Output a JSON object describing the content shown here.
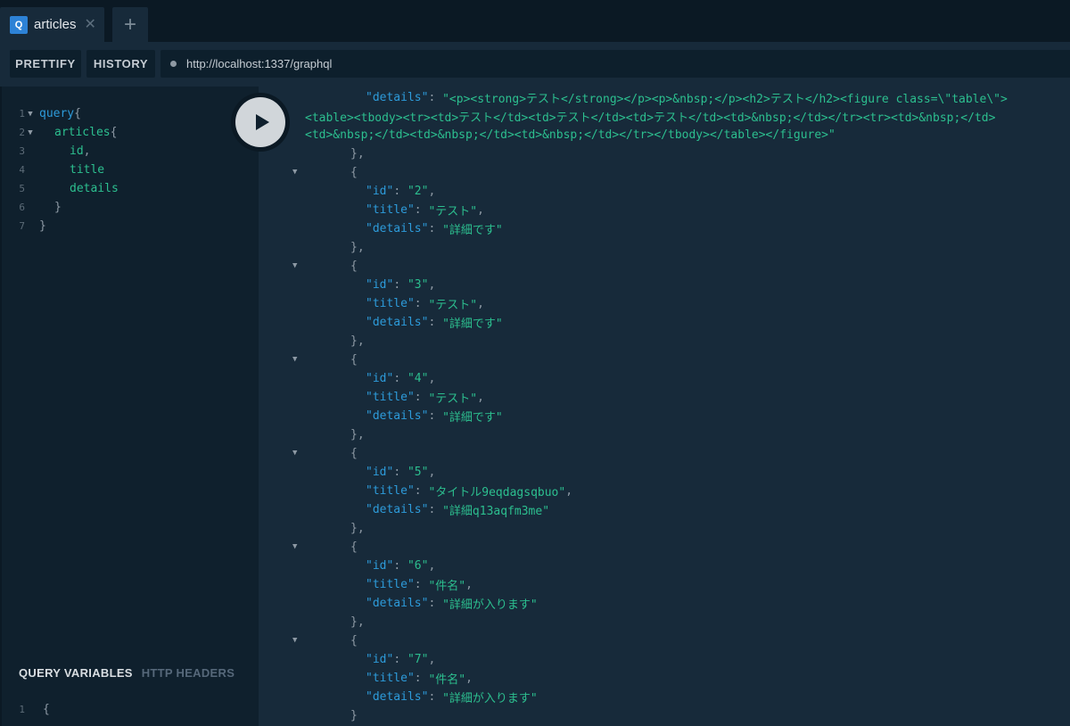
{
  "tab": {
    "icon_letter": "Q",
    "title": "articles",
    "close_glyph": "✕",
    "add_glyph": "+"
  },
  "toolbar": {
    "prettify": "PRETTIFY",
    "history": "HISTORY",
    "url": "http://localhost:1337/graphql"
  },
  "query_lines": [
    {
      "n": "1",
      "indent": 0,
      "arrow": true,
      "parts": [
        {
          "t": "query",
          "c": "kw"
        },
        {
          "t": "{",
          "c": "br"
        }
      ]
    },
    {
      "n": "2",
      "indent": 1,
      "arrow": true,
      "parts": [
        {
          "t": "articles",
          "c": "fld"
        },
        {
          "t": "{",
          "c": "br"
        }
      ]
    },
    {
      "n": "3",
      "indent": 2,
      "arrow": false,
      "parts": [
        {
          "t": "id",
          "c": "fld"
        },
        {
          "t": ",",
          "c": "pun"
        }
      ]
    },
    {
      "n": "4",
      "indent": 2,
      "arrow": false,
      "parts": [
        {
          "t": "title",
          "c": "fld"
        }
      ]
    },
    {
      "n": "5",
      "indent": 2,
      "arrow": false,
      "parts": [
        {
          "t": "details",
          "c": "fld"
        }
      ]
    },
    {
      "n": "6",
      "indent": 1,
      "arrow": false,
      "parts": [
        {
          "t": "}",
          "c": "br"
        }
      ]
    },
    {
      "n": "7",
      "indent": 0,
      "arrow": false,
      "parts": [
        {
          "t": "}",
          "c": "br"
        }
      ]
    }
  ],
  "vars": {
    "active": "QUERY VARIABLES",
    "inactive": "HTTP HEADERS",
    "line_num": "1",
    "line_text": "{"
  },
  "result": {
    "first_details_key": "\"details\"",
    "first_details_value_lines": [
      "\"<p><strong>テスト</strong></p><p>&nbsp;</p><h2>テスト</h2><figure class=\\\"table\\\">",
      "<table><tbody><tr><td>テスト</td><td>テスト</td><td>テスト</td><td>&nbsp;</td></tr><tr><td>&nbsp;</td>",
      "<td>&nbsp;</td><td>&nbsp;</td><td>&nbsp;</td></tr></tbody></table></figure>\""
    ],
    "items": [
      {
        "id": "\"2\"",
        "title": "\"テスト\"",
        "details": "\"詳細です\""
      },
      {
        "id": "\"3\"",
        "title": "\"テスト\"",
        "details": "\"詳細です\""
      },
      {
        "id": "\"4\"",
        "title": "\"テスト\"",
        "details": "\"詳細です\""
      },
      {
        "id": "\"5\"",
        "title": "\"タイトル9eqdagsqbuo\"",
        "details": "\"詳細q13aqfm3me\""
      },
      {
        "id": "\"6\"",
        "title": "\"件名\"",
        "details": "\"詳細が入ります\""
      },
      {
        "id": "\"7\"",
        "title": "\"件名\"",
        "details": "\"詳細が入ります\""
      }
    ],
    "keys": {
      "id": "\"id\"",
      "title": "\"title\"",
      "details": "\"details\""
    },
    "closing_bracket": "]"
  }
}
